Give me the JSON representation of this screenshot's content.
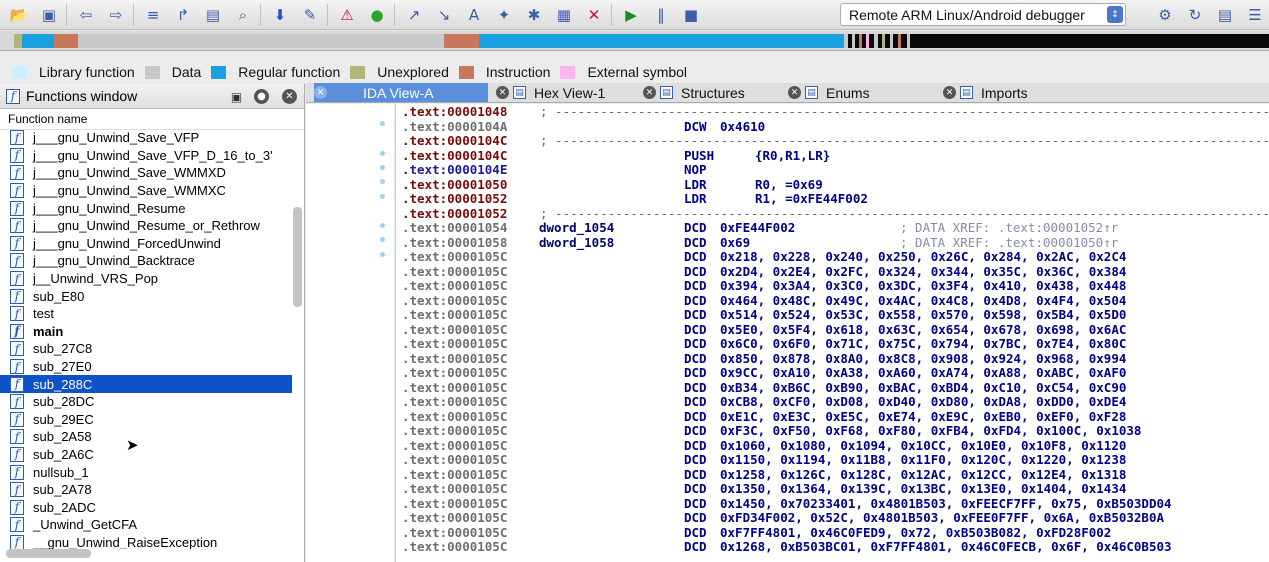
{
  "toolbar": {
    "icons": [
      "open-icon",
      "save-icon",
      "back-icon",
      "forward-icon",
      "binary-icon",
      "jump-icon",
      "segment-icon",
      "search-icon",
      "down-arrow-icon",
      "pencil-icon",
      "stop-icon",
      "green-dot-icon",
      "import-icon",
      "export-icon",
      "text-icon",
      "graph-icon",
      "plugin-icon",
      "calc-icon",
      "close-x-icon",
      "run-icon",
      "pause-icon",
      "stop-square-icon"
    ],
    "debugger_selected": "Remote ARM Linux/Android debugger"
  },
  "legend": [
    {
      "label": "Library function",
      "color": "#c8f0ff"
    },
    {
      "label": "Data",
      "color": "#c8c8c8"
    },
    {
      "label": "Regular function",
      "color": "#1aa0e0"
    },
    {
      "label": "Unexplored",
      "color": "#b4b478"
    },
    {
      "label": "Instruction",
      "color": "#c8785a"
    },
    {
      "label": "External symbol",
      "color": "#ffb4f0"
    }
  ],
  "functions_window": {
    "title": "Functions window",
    "column_header": "Function name",
    "items": [
      {
        "name": "j___gnu_Unwind_Save_VFP",
        "selected": false,
        "bold": false
      },
      {
        "name": "j___gnu_Unwind_Save_VFP_D_16_to_3'",
        "selected": false,
        "bold": false
      },
      {
        "name": "j___gnu_Unwind_Save_WMMXD",
        "selected": false,
        "bold": false
      },
      {
        "name": "j___gnu_Unwind_Save_WMMXC",
        "selected": false,
        "bold": false
      },
      {
        "name": "j___gnu_Unwind_Resume",
        "selected": false,
        "bold": false
      },
      {
        "name": "j___gnu_Unwind_Resume_or_Rethrow",
        "selected": false,
        "bold": false
      },
      {
        "name": "j___gnu_Unwind_ForcedUnwind",
        "selected": false,
        "bold": false
      },
      {
        "name": "j___gnu_Unwind_Backtrace",
        "selected": false,
        "bold": false
      },
      {
        "name": "j__Unwind_VRS_Pop",
        "selected": false,
        "bold": false
      },
      {
        "name": "sub_E80",
        "selected": false,
        "bold": false
      },
      {
        "name": "test",
        "selected": false,
        "bold": false
      },
      {
        "name": "main",
        "selected": false,
        "bold": true
      },
      {
        "name": "sub_27C8",
        "selected": false,
        "bold": false
      },
      {
        "name": "sub_27E0",
        "selected": false,
        "bold": false
      },
      {
        "name": "sub_288C",
        "selected": true,
        "bold": false
      },
      {
        "name": "sub_28DC",
        "selected": false,
        "bold": false
      },
      {
        "name": "sub_29EC",
        "selected": false,
        "bold": false
      },
      {
        "name": "sub_2A58",
        "selected": false,
        "bold": false
      },
      {
        "name": "sub_2A6C",
        "selected": false,
        "bold": false
      },
      {
        "name": "nullsub_1",
        "selected": false,
        "bold": false
      },
      {
        "name": "sub_2A78",
        "selected": false,
        "bold": false
      },
      {
        "name": "sub_2ADC",
        "selected": false,
        "bold": false
      },
      {
        "name": "_Unwind_GetCFA",
        "selected": false,
        "bold": false
      },
      {
        "name": "__gnu_Unwind_RaiseException",
        "selected": false,
        "bold": false
      }
    ]
  },
  "tabs": [
    {
      "label": "IDA View-A",
      "active": true
    },
    {
      "label": "Hex View-1",
      "active": false
    },
    {
      "label": "Structures",
      "active": false
    },
    {
      "label": "Enums",
      "active": false
    },
    {
      "label": "Imports",
      "active": false
    }
  ],
  "disassembly": [
    {
      "addr": ".text:00001048",
      "kind": "hl",
      "sep": true
    },
    {
      "addr": ".text:0000104A",
      "kind": "plain",
      "mn": "DCW",
      "op": "0x4610"
    },
    {
      "addr": ".text:0000104C",
      "kind": "hl",
      "sep": true
    },
    {
      "addr": ".text:0000104C",
      "kind": "hl",
      "mn": "PUSH",
      "op": "{R0,R1,LR}"
    },
    {
      "addr": ".text:0000104E",
      "kind": "nav",
      "mn": "NOP",
      "op": ""
    },
    {
      "addr": ".text:00001050",
      "kind": "hl",
      "mn": "LDR",
      "op": "R0, =0x69"
    },
    {
      "addr": ".text:00001052",
      "kind": "hl",
      "mn": "LDR",
      "op": "R1, =0xFE44F002"
    },
    {
      "addr": ".text:00001052",
      "kind": "hl",
      "sep": true
    },
    {
      "addr": ".text:00001054",
      "kind": "plain",
      "label": "dword_1054",
      "mn": "DCD",
      "op": "0xFE44F002",
      "cm": "; DATA XREF: .text:00001052↑r"
    },
    {
      "addr": ".text:00001058",
      "kind": "plain",
      "label": "dword_1058",
      "mn": "DCD",
      "op": "0x69",
      "cm": "; DATA XREF: .text:00001050↑r"
    },
    {
      "addr": ".text:0000105C",
      "kind": "plain",
      "mn": "DCD",
      "op": "0x218, 0x228, 0x240, 0x250, 0x26C, 0x284, 0x2AC, 0x2C4"
    },
    {
      "addr": ".text:0000105C",
      "kind": "plain",
      "mn": "DCD",
      "op": "0x2D4, 0x2E4, 0x2FC, 0x324, 0x344, 0x35C, 0x36C, 0x384"
    },
    {
      "addr": ".text:0000105C",
      "kind": "plain",
      "mn": "DCD",
      "op": "0x394, 0x3A4, 0x3C0, 0x3DC, 0x3F4, 0x410, 0x438, 0x448"
    },
    {
      "addr": ".text:0000105C",
      "kind": "plain",
      "mn": "DCD",
      "op": "0x464, 0x48C, 0x49C, 0x4AC, 0x4C8, 0x4D8, 0x4F4, 0x504"
    },
    {
      "addr": ".text:0000105C",
      "kind": "plain",
      "mn": "DCD",
      "op": "0x514, 0x524, 0x53C, 0x558, 0x570, 0x598, 0x5B4, 0x5D0"
    },
    {
      "addr": ".text:0000105C",
      "kind": "plain",
      "mn": "DCD",
      "op": "0x5E0, 0x5F4, 0x618, 0x63C, 0x654, 0x678, 0x698, 0x6AC"
    },
    {
      "addr": ".text:0000105C",
      "kind": "plain",
      "mn": "DCD",
      "op": "0x6C0, 0x6F0, 0x71C, 0x75C, 0x794, 0x7BC, 0x7E4, 0x80C"
    },
    {
      "addr": ".text:0000105C",
      "kind": "plain",
      "mn": "DCD",
      "op": "0x850, 0x878, 0x8A0, 0x8C8, 0x908, 0x924, 0x968, 0x994"
    },
    {
      "addr": ".text:0000105C",
      "kind": "plain",
      "mn": "DCD",
      "op": "0x9CC, 0xA10, 0xA38, 0xA60, 0xA74, 0xA88, 0xABC, 0xAF0"
    },
    {
      "addr": ".text:0000105C",
      "kind": "plain",
      "mn": "DCD",
      "op": "0xB34, 0xB6C, 0xB90, 0xBAC, 0xBD4, 0xC10, 0xC54, 0xC90"
    },
    {
      "addr": ".text:0000105C",
      "kind": "plain",
      "mn": "DCD",
      "op": "0xCB8, 0xCF0, 0xD08, 0xD40, 0xD80, 0xDA8, 0xDD0, 0xDE4"
    },
    {
      "addr": ".text:0000105C",
      "kind": "plain",
      "mn": "DCD",
      "op": "0xE1C, 0xE3C, 0xE5C, 0xE74, 0xE9C, 0xEB0, 0xEF0, 0xF28"
    },
    {
      "addr": ".text:0000105C",
      "kind": "plain",
      "mn": "DCD",
      "op": "0xF3C, 0xF50, 0xF68, 0xF80, 0xFB4, 0xFD4, 0x100C, 0x1038"
    },
    {
      "addr": ".text:0000105C",
      "kind": "plain",
      "mn": "DCD",
      "op": "0x1060, 0x1080, 0x1094, 0x10CC, 0x10E0, 0x10F8, 0x1120"
    },
    {
      "addr": ".text:0000105C",
      "kind": "plain",
      "mn": "DCD",
      "op": "0x1150, 0x1194, 0x11B8, 0x11F0, 0x120C, 0x1220, 0x1238"
    },
    {
      "addr": ".text:0000105C",
      "kind": "plain",
      "mn": "DCD",
      "op": "0x1258, 0x126C, 0x128C, 0x12AC, 0x12CC, 0x12E4, 0x1318"
    },
    {
      "addr": ".text:0000105C",
      "kind": "plain",
      "mn": "DCD",
      "op": "0x1350, 0x1364, 0x139C, 0x13BC, 0x13E0, 0x1404, 0x1434"
    },
    {
      "addr": ".text:0000105C",
      "kind": "plain",
      "mn": "DCD",
      "op": "0x1450, 0x70233401, 0x4801B503, 0xFEECF7FF, 0x75, 0xB503DD04"
    },
    {
      "addr": ".text:0000105C",
      "kind": "plain",
      "mn": "DCD",
      "op": "0xFD34F002, 0x52C, 0x4801B503, 0xFEE0F7FF, 0x6A, 0xB5032B0A"
    },
    {
      "addr": ".text:0000105C",
      "kind": "plain",
      "mn": "DCD",
      "op": "0xF7FF4801, 0x46C0FED9, 0x72, 0xB503B082, 0xFD28F002"
    },
    {
      "addr": ".text:0000105C",
      "kind": "plain",
      "mn": "DCD",
      "op": "0x1268, 0xB503BC01, 0xF7FF4801, 0x46C0FECB, 0x6F, 0x46C0B503"
    }
  ]
}
